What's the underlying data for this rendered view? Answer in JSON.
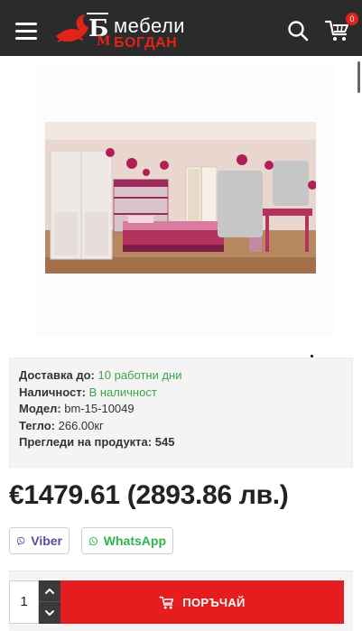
{
  "header": {
    "logo_line1": "мебели",
    "logo_line2": "БОГДАН",
    "cart_count": "0",
    "icons": [
      "hamburger-menu-icon",
      "search-icon",
      "cart-icon"
    ]
  },
  "product": {
    "delivery_label": "Доставка до:",
    "delivery_value": "10 работни дни",
    "availability_label": "Наличност:",
    "availability_value": "В наличност",
    "model_label": "Модел:",
    "model_value": "bm-15-10049",
    "weight_label": "Тегло:",
    "weight_value": "266.00кг",
    "views_label": "Прегледи на продукта:",
    "views_value": "545",
    "price": "€1479.61 (2893.86 лв.)"
  },
  "share": {
    "viber_label": "Viber",
    "whatsapp_label": "WhatsApp"
  },
  "order": {
    "quantity": "1",
    "order_button_label": "ПОРЪЧАЙ"
  },
  "colors": {
    "header_bg": "#2b2b2b",
    "brand_red": "#e2231a",
    "accent_green": "#3fa34d",
    "viber_purple": "#5b4a9e",
    "whatsapp_green": "#2fb350"
  }
}
